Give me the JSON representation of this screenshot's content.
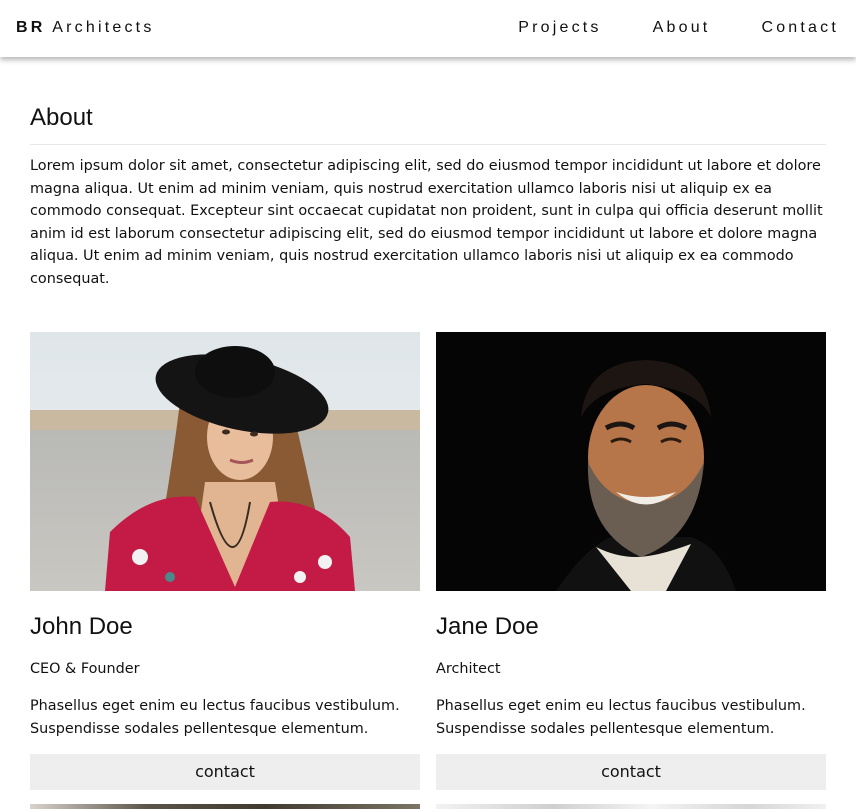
{
  "brand": {
    "bold": "BR",
    "rest": "Architects"
  },
  "nav": {
    "links": [
      "Projects",
      "About",
      "Contact"
    ]
  },
  "about": {
    "title": "About",
    "text": "Lorem ipsum dolor sit amet, consectetur adipiscing elit, sed do eiusmod tempor incididunt ut labore et dolore magna aliqua. Ut enim ad minim veniam, quis nostrud exercitation ullamco laboris nisi ut aliquip ex ea commodo consequat. Excepteur sint occaecat cupidatat non proident, sunt in culpa qui officia deserunt mollit anim id est laborum consectetur adipiscing elit, sed do eiusmod tempor incididunt ut labore et dolore magna aliqua. Ut enim ad minim veniam, quis nostrud exercitation ullamco laboris nisi ut aliquip ex ea commodo consequat."
  },
  "team": [
    {
      "name": "John Doe",
      "role": "CEO & Founder",
      "bio": "Phasellus eget enim eu lectus faucibus vestibulum. Suspendisse sodales pellentesque elementum.",
      "button": "contact"
    },
    {
      "name": "Jane Doe",
      "role": "Architect",
      "bio": "Phasellus eget enim eu lectus faucibus vestibulum. Suspendisse sodales pellentesque elementum.",
      "button": "contact"
    }
  ]
}
